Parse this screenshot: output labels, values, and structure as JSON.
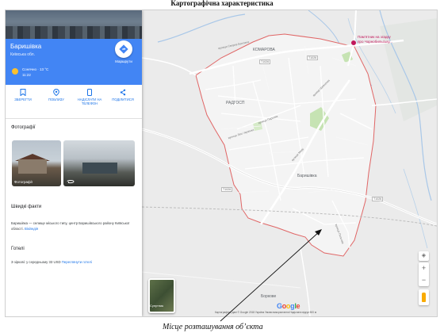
{
  "document": {
    "title": "Картографічна характеристика",
    "caption": "Місце розташування об’єкта"
  },
  "panel": {
    "place_name": "Баришівка",
    "region": "Київська обл.",
    "weather": "Сонячно · 13 °C",
    "weather_time": "11:22",
    "directions_label": "Маршрути",
    "actions": [
      {
        "label": "ЗБЕРЕГТИ",
        "icon": "bookmark-icon"
      },
      {
        "label": "ПОБЛИЗУ",
        "icon": "nearby-pin-icon"
      },
      {
        "label": "НАДІСЛАТИ НА ТЕЛЕФОН",
        "icon": "send-to-phone-icon"
      },
      {
        "label": "ПОДІЛИТИСЯ",
        "icon": "share-icon"
      }
    ],
    "photos_title": "Фотографії",
    "photo_label": "Фотографії",
    "facts_title": "Швидкі факти",
    "facts_text": "Баришівка — селище міського типу, центр Баришівського району Київської області.",
    "facts_link": "Вікіпедія",
    "hotels_title": "Готелі",
    "hotels_text": "3-зіркові: у середньому 33 USD",
    "hotels_link": "Переглянути готелі"
  },
  "map": {
    "district_labels": [
      "КОМАРОВА",
      "РАДГОСП",
      "Баришівка",
      "Боркове"
    ],
    "poi": "Пам’ятник на згадку\nпро Чорнобильську...",
    "road_labels": [
      "Т1026",
      "Т1026",
      "Т1026",
      "Т1026"
    ],
    "street_labels": [
      "вулиця Сверла Беллина",
      "вулиця Шевченка",
      "вулиця Паркова",
      "вулиця Лесі Українки",
      "вулиця Миру",
      "вулиця Польова"
    ],
    "satellite_label": "Супутник",
    "google_logo": "Google",
    "attribution": "Картографічні дані © Google 2018   Україна   Умови використання   Надіслати відгук   500 м",
    "zoom_in": "+",
    "zoom_out": "−",
    "accent_color": "#4285f4",
    "boundary_color": "#e06666"
  }
}
